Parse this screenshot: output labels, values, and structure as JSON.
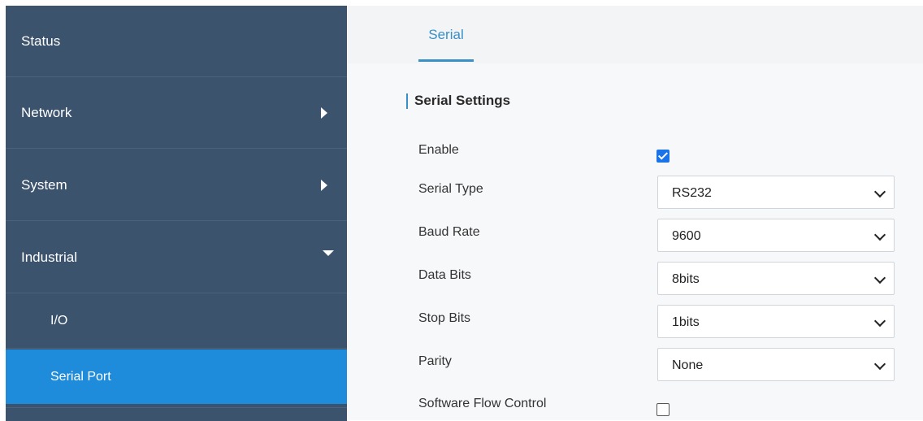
{
  "sidebar": {
    "items": [
      {
        "label": "Status"
      },
      {
        "label": "Network"
      },
      {
        "label": "System"
      },
      {
        "label": "Industrial"
      }
    ],
    "sub_items": [
      {
        "label": "I/O"
      },
      {
        "label": "Serial Port"
      }
    ]
  },
  "tabs": [
    {
      "label": "Serial"
    }
  ],
  "section": {
    "title": "Serial Settings"
  },
  "fields": {
    "enable": {
      "label": "Enable",
      "checked": true
    },
    "serial_type": {
      "label": "Serial Type",
      "value": "RS232"
    },
    "baud_rate": {
      "label": "Baud Rate",
      "value": "9600"
    },
    "data_bits": {
      "label": "Data Bits",
      "value": "8bits"
    },
    "stop_bits": {
      "label": "Stop Bits",
      "value": "1bits"
    },
    "parity": {
      "label": "Parity",
      "value": "None"
    },
    "software_flow_control": {
      "label": "Software Flow Control",
      "checked": false
    }
  },
  "colors": {
    "sidebar_bg": "#3c536e",
    "active_item": "#1f8bdb",
    "accent": "#3a8fc7",
    "checkbox_checked": "#1a73e8"
  }
}
